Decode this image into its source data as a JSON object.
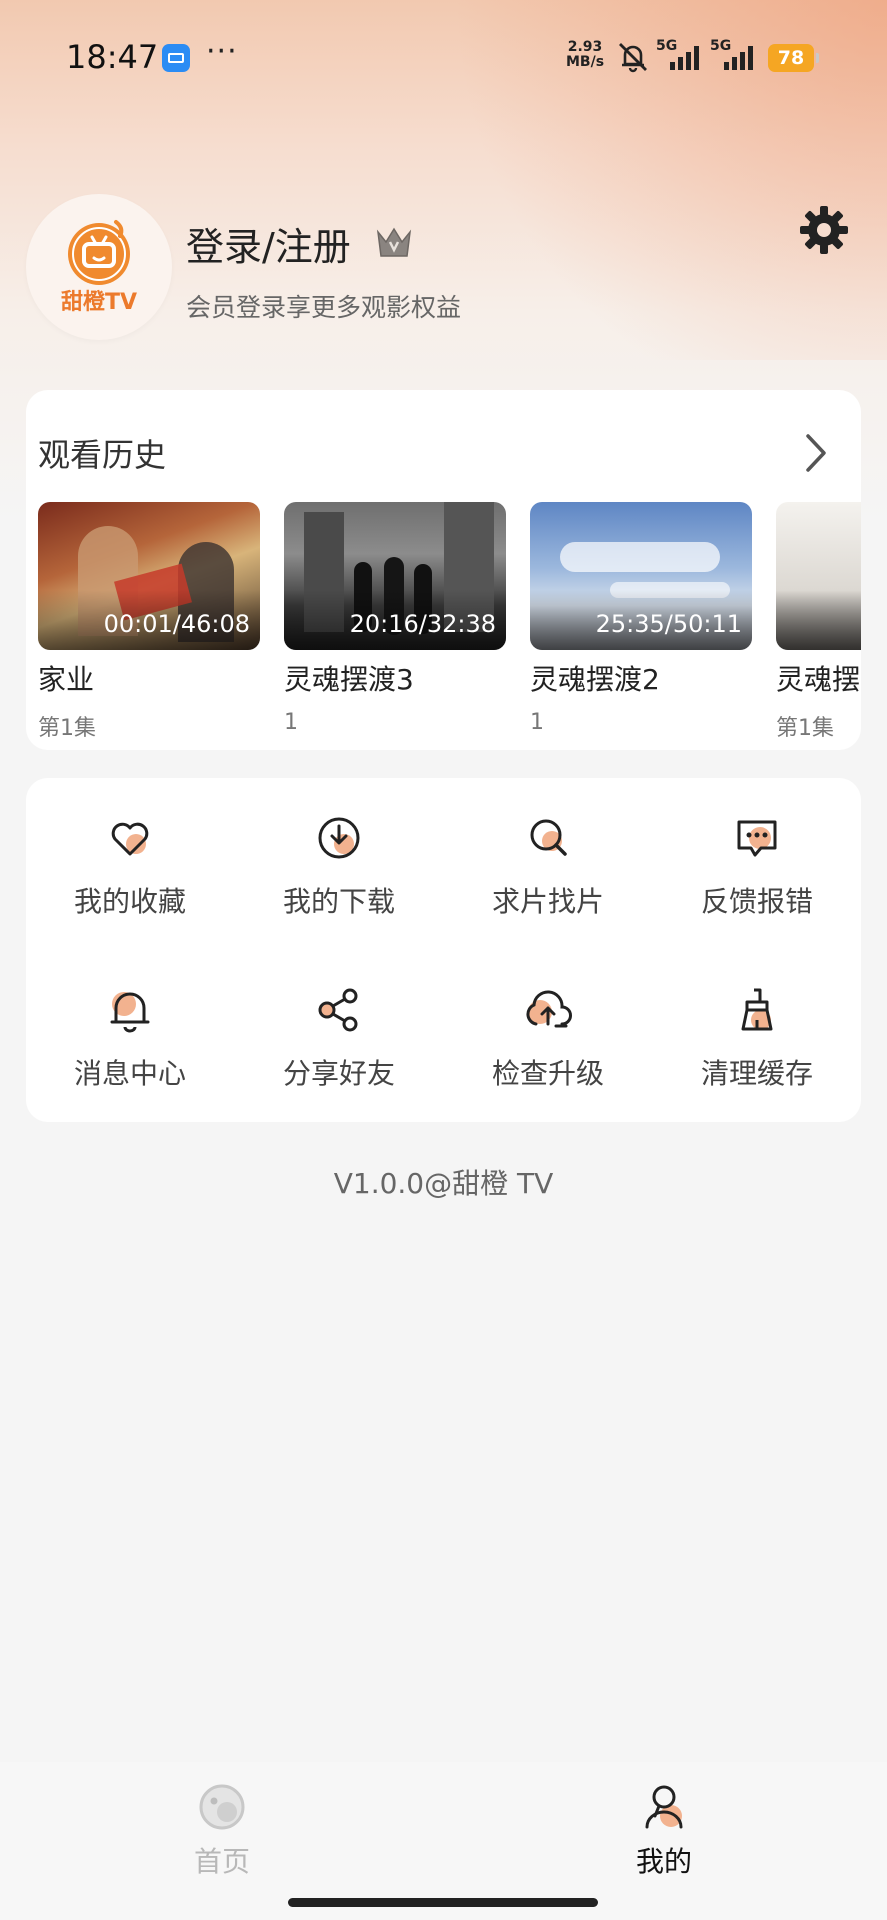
{
  "status_bar": {
    "time": "18:47",
    "dots": "···",
    "net_speed_value": "2.93",
    "net_speed_unit": "MB/s",
    "signal1": "5G",
    "signal2": "5G",
    "battery": "78"
  },
  "profile": {
    "logo_text": "甜橙TV",
    "login_title": "登录/注册",
    "login_subtitle": "会员登录享更多观影权益"
  },
  "history": {
    "title": "观看历史",
    "items": [
      {
        "name": "家业",
        "progress": "00:01/46:08",
        "episode": "第1集"
      },
      {
        "name": "灵魂摆渡3",
        "progress": "20:16/32:38",
        "episode": "1"
      },
      {
        "name": "灵魂摆渡2",
        "progress": "25:35/50:11",
        "episode": "1"
      },
      {
        "name": "灵魂摆",
        "progress": "",
        "episode": "第1集"
      }
    ]
  },
  "menu": {
    "items": [
      {
        "label": "我的收藏",
        "icon": "heart-icon"
      },
      {
        "label": "我的下载",
        "icon": "download-icon"
      },
      {
        "label": "求片找片",
        "icon": "search-icon"
      },
      {
        "label": "反馈报错",
        "icon": "feedback-icon"
      },
      {
        "label": "消息中心",
        "icon": "bell-icon"
      },
      {
        "label": "分享好友",
        "icon": "share-icon"
      },
      {
        "label": "检查升级",
        "icon": "upload-cloud-icon"
      },
      {
        "label": "清理缓存",
        "icon": "broom-icon"
      }
    ]
  },
  "version": "V1.0.0@甜橙 TV",
  "nav": {
    "home": "首页",
    "mine": "我的"
  },
  "colors": {
    "accent": "#f2b28f",
    "brand_orange": "#ec7a2c"
  }
}
